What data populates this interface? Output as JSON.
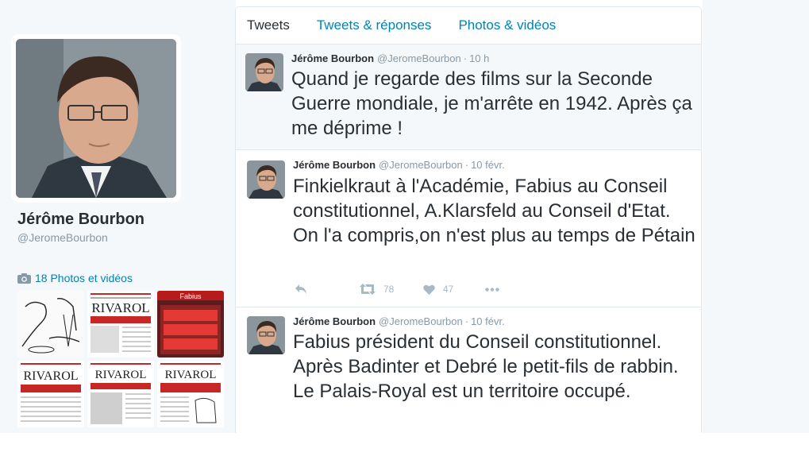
{
  "profile": {
    "name": "Jérôme Bourbon",
    "handle": "@JeromeBourbon",
    "media_link": "18 Photos et vidéos",
    "thumbnails": [
      "RIVAROL",
      "Fabius",
      "RIVAROL",
      "RIVAROL"
    ]
  },
  "tabs": [
    {
      "label": "Tweets"
    },
    {
      "label": "Tweets & réponses"
    },
    {
      "label": "Photos & vidéos"
    }
  ],
  "tweets": [
    {
      "name": "Jérôme Bourbon",
      "handle": "@JeromeBourbon",
      "dot": "·",
      "time": "10 h",
      "text": "Quand je regarde des films sur la Seconde Guerre mondiale, je m'arrête en 1942. Après ça me déprime !"
    },
    {
      "name": "Jérôme Bourbon",
      "handle": "@JeromeBourbon",
      "dot": "·",
      "time": "10 févr.",
      "text": "Finkielkraut à l'Académie, Fabius au Conseil constitutionnel, A.Klarsfeld au Conseil d'Etat. On l'a compris,on n'est plus au temps de Pétain",
      "retweets": "78",
      "likes": "47"
    },
    {
      "name": "Jérôme Bourbon",
      "handle": "@JeromeBourbon",
      "dot": "·",
      "time": "10 févr.",
      "text": "Fabius président du Conseil constitutionnel. Après Badinter et Debré le petit-fils de rabbin. Le Palais-Royal est un territoire occupé."
    }
  ],
  "colors": {
    "link": "#0084b4",
    "muted": "#8899a6",
    "text": "#292f33",
    "action_icon": "#aab8c2",
    "border": "#e1e8ed"
  },
  "icons": [
    "camera-icon",
    "reply-icon",
    "retweet-icon",
    "heart-icon",
    "more-icon"
  ]
}
